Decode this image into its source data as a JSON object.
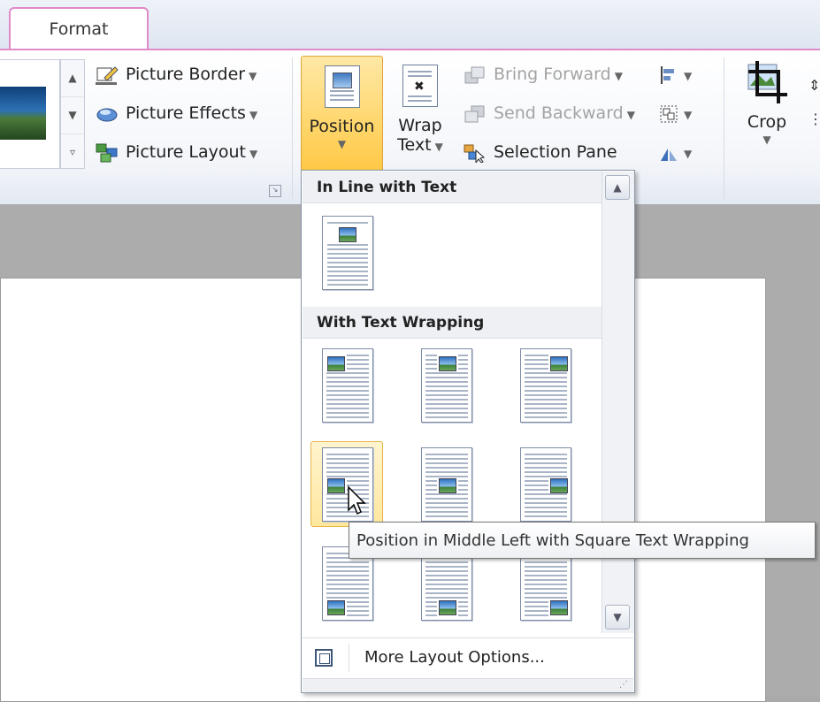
{
  "tabs": {
    "format": "Format"
  },
  "picture_styles": {
    "border_label": "Picture Border",
    "effects_label": "Picture Effects",
    "layout_label": "Picture Layout"
  },
  "arrange": {
    "position_label": "Position",
    "wrap_label_1": "Wrap",
    "wrap_label_2": "Text",
    "bring_forward_label": "Bring Forward",
    "send_backward_label": "Send Backward",
    "selection_pane_label": "Selection Pane"
  },
  "size": {
    "crop_label": "Crop"
  },
  "position_menu": {
    "inline_header": "In Line with Text",
    "wrapping_header": "With Text Wrapping",
    "more_options_label": "More Layout Options...",
    "options": [
      {
        "name": "in-line-with-text"
      },
      {
        "name": "top-left"
      },
      {
        "name": "top-center"
      },
      {
        "name": "top-right"
      },
      {
        "name": "middle-left",
        "hovered": true
      },
      {
        "name": "middle-center"
      },
      {
        "name": "middle-right"
      },
      {
        "name": "bottom-left"
      },
      {
        "name": "bottom-center"
      },
      {
        "name": "bottom-right"
      }
    ]
  },
  "tooltip": {
    "text": "Position in Middle Left with Square Text Wrapping"
  },
  "colors": {
    "accent_pink": "#e08ac8",
    "hover_gold": "#ffd66b"
  },
  "icons": [
    "picture-border-icon",
    "picture-effects-icon",
    "picture-layout-icon",
    "position-icon",
    "wrap-text-icon",
    "bring-forward-icon",
    "send-backward-icon",
    "selection-pane-icon",
    "align-icon",
    "group-icon",
    "rotate-icon",
    "crop-icon",
    "more-layout-options-icon",
    "mouse-cursor-icon"
  ]
}
